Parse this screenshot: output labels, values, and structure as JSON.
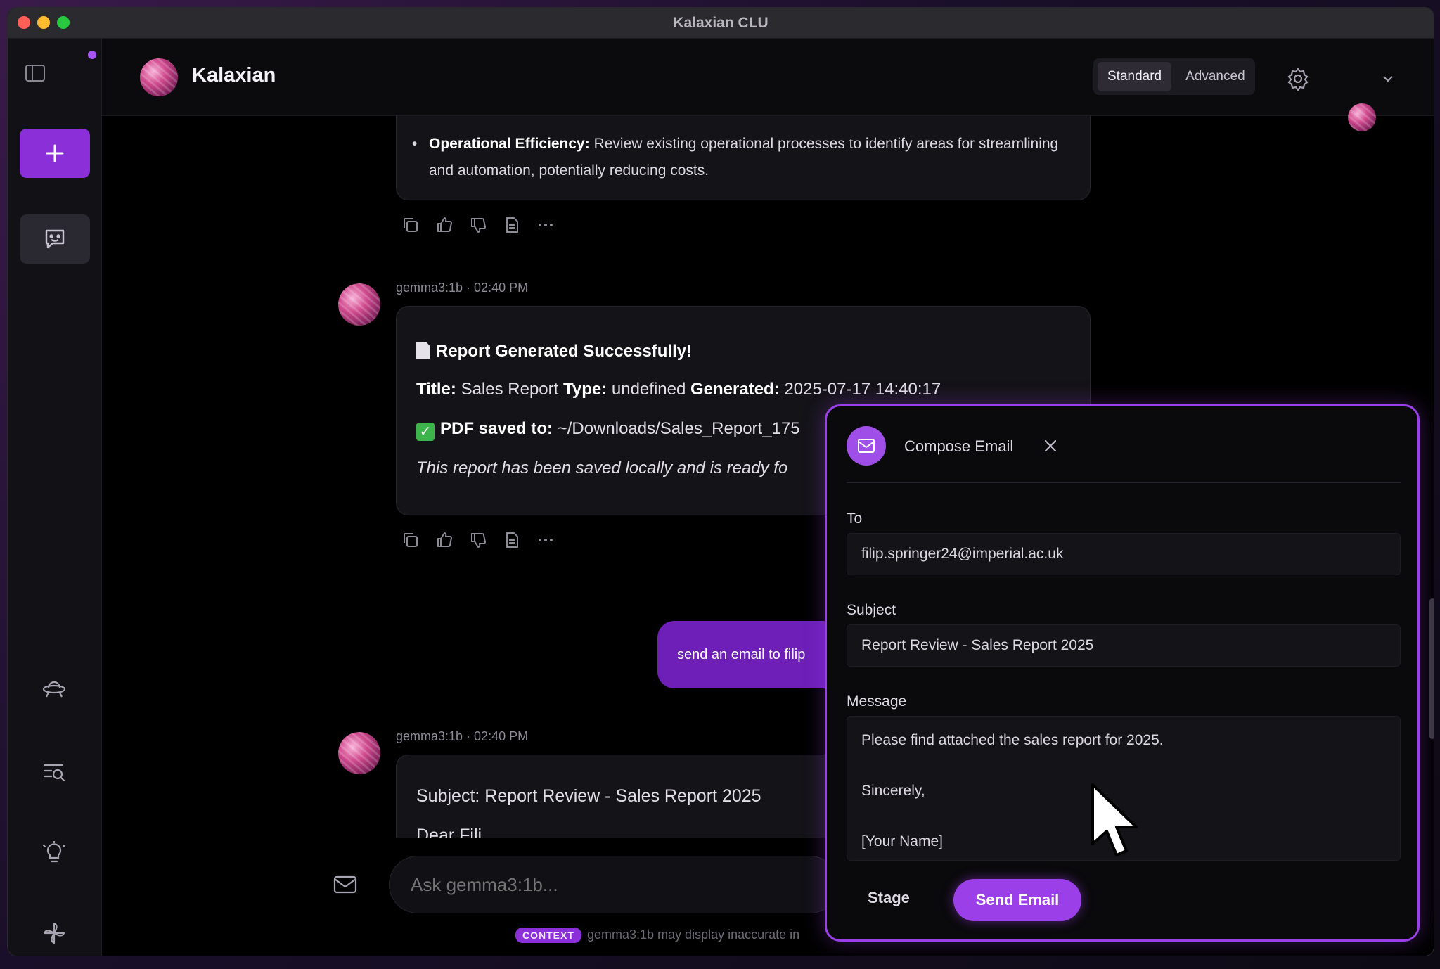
{
  "window": {
    "title": "Kalaxian CLU"
  },
  "header": {
    "brand": "Kalaxian",
    "modes": [
      "Standard",
      "Advanced"
    ],
    "active_mode": "Standard"
  },
  "messages": {
    "m1": {
      "bold": "Operational Efficiency:",
      "text": " Review existing operational processes to identify areas for streamlining and automation, potentially reducing costs."
    },
    "m2": {
      "meta": "gemma3:1b · 02:40 PM",
      "heading": "Report Generated Successfully!",
      "title_label": "Title:",
      "title_value": " Sales Report ",
      "type_label": "Type:",
      "type_value": " undefined ",
      "generated_label": "Generated:",
      "generated_value": " 2025-07-17 14:40:17",
      "pdf_label": "PDF saved to:",
      "pdf_value": " ~/Downloads/Sales_Report_175",
      "note": "This report has been saved locally and is ready fo"
    },
    "user": {
      "text": "send an email to filip"
    },
    "m3": {
      "meta": "gemma3:1b · 02:40 PM",
      "subject": "Subject: Report Review - Sales Report 2025",
      "partial": "Dear Fili"
    }
  },
  "composer": {
    "placeholder": "Ask gemma3:1b...",
    "context_badge": "CONTEXT",
    "disclaimer": "gemma3:1b may display inaccurate in"
  },
  "email": {
    "title": "Compose Email",
    "to_label": "To",
    "to_value": "filip.springer24@imperial.ac.uk",
    "subject_label": "Subject",
    "subject_value": "Report Review - Sales Report 2025",
    "message_label": "Message",
    "message_value": "Please find attached the sales report for 2025.\n\nSincerely,\n\n[Your Name]",
    "stage_label": "Stage",
    "send_label": "Send Email"
  },
  "colors": {
    "accent": "#9b3fe8",
    "user_bubble": "#6d1fb8",
    "background": "#000000"
  }
}
